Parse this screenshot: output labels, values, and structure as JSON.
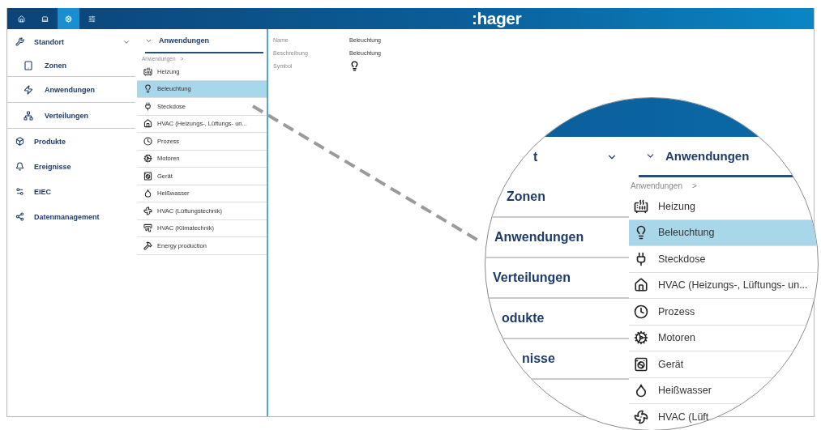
{
  "topbar": {
    "tabs": [
      {
        "selected": false
      },
      {
        "selected": false
      },
      {
        "selected": true
      },
      {
        "selected": false
      }
    ],
    "logo": ":hager"
  },
  "sidebar": {
    "items": [
      {
        "label": "Standort",
        "expanded": true,
        "children": [
          {
            "label": "Zonen"
          },
          {
            "label": "Anwendungen"
          },
          {
            "label": "Verteilungen"
          }
        ]
      },
      {
        "label": "Produkte"
      },
      {
        "label": "Ereignisse"
      },
      {
        "label": "EIEC"
      },
      {
        "label": "Datenmanagement"
      }
    ]
  },
  "list": {
    "header": "Anwendungen",
    "breadcrumb": "Anwendungen",
    "breadcrumb_separator": ">",
    "items": [
      {
        "label": "Heizung",
        "selected": false
      },
      {
        "label": "Beleuchtung",
        "selected": true
      },
      {
        "label": "Steckdose",
        "selected": false
      },
      {
        "label": "HVAC (Heizungs-, Lüftungs- un...",
        "selected": false
      },
      {
        "label": "Prozess",
        "selected": false
      },
      {
        "label": "Motoren",
        "selected": false
      },
      {
        "label": "Gerät",
        "selected": false
      },
      {
        "label": "Heißwasser",
        "selected": false
      },
      {
        "label": "HVAC (Lüftungstechnik)",
        "selected": false
      },
      {
        "label": "HVAC (Klimatechnik)",
        "selected": false
      },
      {
        "label": "Energy production",
        "selected": false
      }
    ]
  },
  "details": {
    "fields": [
      {
        "kind": "text",
        "label": "Name",
        "value": "Beleuchtung"
      },
      {
        "kind": "text",
        "label": "Beschreibung",
        "value": "Beleuchtung"
      },
      {
        "kind": "icon",
        "label": "Symbol"
      }
    ]
  },
  "magnifier": {
    "sidebar_items": [
      {
        "label": "t",
        "kind": "expandable"
      },
      {
        "label": "Zonen",
        "kind": "plain"
      },
      {
        "label": "Anwendungen",
        "kind": "plain"
      },
      {
        "label": "Verteilungen",
        "kind": "plain"
      },
      {
        "label": "odukte",
        "kind": "plain"
      },
      {
        "label": "nisse",
        "kind": "plain"
      }
    ],
    "header": "Anwendungen",
    "breadcrumb": "Anwendungen",
    "breadcrumb_separator": ">",
    "items": [
      {
        "label": "Heizung",
        "selected": false
      },
      {
        "label": "Beleuchtung",
        "selected": true
      },
      {
        "label": "Steckdose",
        "selected": false
      },
      {
        "label": "HVAC (Heizungs-, Lüftungs- un...",
        "selected": false
      },
      {
        "label": "Prozess",
        "selected": false
      },
      {
        "label": "Motoren",
        "selected": false
      },
      {
        "label": "Gerät",
        "selected": false
      },
      {
        "label": "Heißwasser",
        "selected": false
      },
      {
        "label": "HVAC (Lüft",
        "selected": false
      }
    ]
  }
}
